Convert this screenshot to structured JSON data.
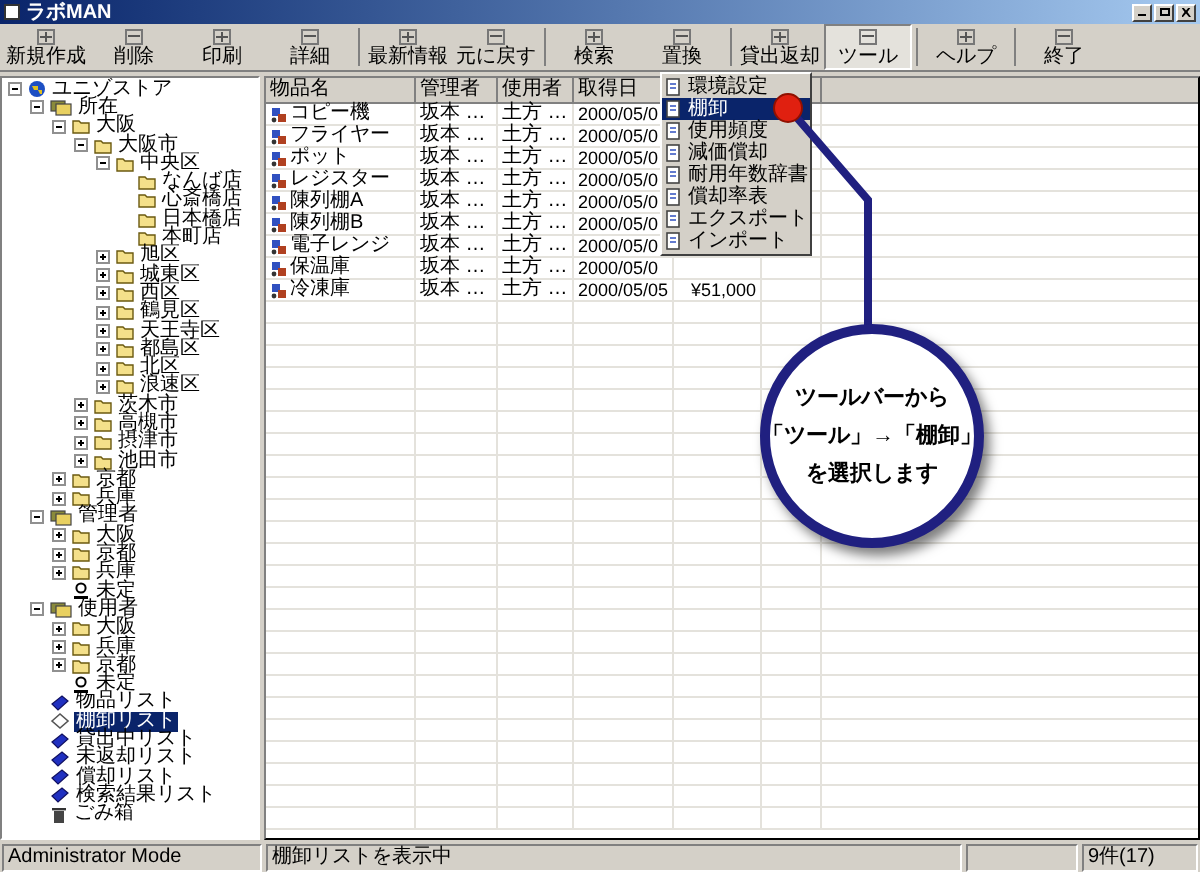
{
  "window": {
    "title": "ラボMAN"
  },
  "toolbar": [
    {
      "label": "新規作成",
      "pressed": false
    },
    {
      "label": "削除",
      "pressed": false
    },
    {
      "label": "印刷",
      "pressed": false
    },
    {
      "label": "詳細",
      "pressed": false
    },
    {
      "label": "最新情報",
      "pressed": false
    },
    {
      "label": "元に戻す",
      "pressed": false
    },
    {
      "label": "検索",
      "pressed": false
    },
    {
      "label": "置換",
      "pressed": false
    },
    {
      "label": "貸出返却",
      "pressed": false
    },
    {
      "label": "ツール",
      "pressed": true
    },
    {
      "label": "ヘルプ",
      "pressed": false
    },
    {
      "label": "終了",
      "pressed": false
    }
  ],
  "tree": [
    {
      "label": "ユニゾストア",
      "kind": "root",
      "expanded": true,
      "selected": false,
      "children": [
        {
          "label": "所在",
          "kind": "group",
          "expanded": true,
          "selected": false,
          "children": [
            {
              "label": "大阪",
              "kind": "folder",
              "expanded": true,
              "selected": false,
              "children": [
                {
                  "label": "大阪市",
                  "kind": "folder",
                  "expanded": true,
                  "selected": false,
                  "children": [
                    {
                      "label": "中央区",
                      "kind": "folder",
                      "expanded": true,
                      "selected": false,
                      "children": [
                        {
                          "label": "なんば店",
                          "kind": "folder",
                          "selected": false
                        },
                        {
                          "label": "心斎橋店",
                          "kind": "folder",
                          "selected": false
                        },
                        {
                          "label": "日本橋店",
                          "kind": "folder",
                          "selected": false
                        },
                        {
                          "label": "本町店",
                          "kind": "folder",
                          "selected": false
                        }
                      ]
                    },
                    {
                      "label": "旭区",
                      "kind": "folder",
                      "expanded": false,
                      "selected": false
                    },
                    {
                      "label": "城東区",
                      "kind": "folder",
                      "expanded": false,
                      "selected": false
                    },
                    {
                      "label": "西区",
                      "kind": "folder",
                      "expanded": false,
                      "selected": false
                    },
                    {
                      "label": "鶴見区",
                      "kind": "folder",
                      "expanded": false,
                      "selected": false
                    },
                    {
                      "label": "天王寺区",
                      "kind": "folder",
                      "expanded": false,
                      "selected": false
                    },
                    {
                      "label": "都島区",
                      "kind": "folder",
                      "expanded": false,
                      "selected": false
                    },
                    {
                      "label": "北区",
                      "kind": "folder",
                      "expanded": false,
                      "selected": false
                    },
                    {
                      "label": "浪速区",
                      "kind": "folder",
                      "expanded": false,
                      "selected": false
                    }
                  ]
                },
                {
                  "label": "茨木市",
                  "kind": "folder",
                  "expanded": false,
                  "selected": false
                },
                {
                  "label": "高槻市",
                  "kind": "folder",
                  "expanded": false,
                  "selected": false
                },
                {
                  "label": "摂津市",
                  "kind": "folder",
                  "expanded": false,
                  "selected": false
                },
                {
                  "label": "池田市",
                  "kind": "folder",
                  "expanded": false,
                  "selected": false
                }
              ]
            },
            {
              "label": "京都",
              "kind": "folder",
              "expanded": false,
              "selected": false
            },
            {
              "label": "兵庫",
              "kind": "folder",
              "expanded": false,
              "selected": false
            }
          ]
        },
        {
          "label": "管理者",
          "kind": "group",
          "expanded": true,
          "selected": false,
          "children": [
            {
              "label": "大阪",
              "kind": "folder",
              "expanded": false,
              "selected": false
            },
            {
              "label": "京都",
              "kind": "folder",
              "expanded": false,
              "selected": false
            },
            {
              "label": "兵庫",
              "kind": "folder",
              "expanded": false,
              "selected": false
            },
            {
              "label": "未定",
              "kind": "person",
              "selected": false
            }
          ]
        },
        {
          "label": "使用者",
          "kind": "group",
          "expanded": true,
          "selected": false,
          "children": [
            {
              "label": "大阪",
              "kind": "folder",
              "expanded": false,
              "selected": false
            },
            {
              "label": "兵庫",
              "kind": "folder",
              "expanded": false,
              "selected": false
            },
            {
              "label": "京都",
              "kind": "folder",
              "expanded": false,
              "selected": false
            },
            {
              "label": "未定",
              "kind": "person",
              "selected": false
            }
          ]
        },
        {
          "label": "物品リスト",
          "kind": "list",
          "selected": false
        },
        {
          "label": "棚卸リスト",
          "kind": "list",
          "selected": true
        },
        {
          "label": "貸出中リスト",
          "kind": "list",
          "selected": false
        },
        {
          "label": "未返却リスト",
          "kind": "list",
          "selected": false
        },
        {
          "label": "償却リスト",
          "kind": "list",
          "selected": false
        },
        {
          "label": "検索結果リスト",
          "kind": "list",
          "selected": false
        },
        {
          "label": "ごみ箱",
          "kind": "trash",
          "selected": false
        }
      ]
    }
  ],
  "table": {
    "columns": [
      "物品名",
      "管理者",
      "使用者",
      "取得日"
    ],
    "rows": [
      [
        "コピー機",
        "坂本 …",
        "土方 …",
        "2000/05/0"
      ],
      [
        "フライヤー",
        "坂本 …",
        "土方 …",
        "2000/05/0"
      ],
      [
        "ポット",
        "坂本 …",
        "土方 …",
        "2000/05/0"
      ],
      [
        "レジスター",
        "坂本 …",
        "土方 …",
        "2000/05/0"
      ],
      [
        "陳列棚A",
        "坂本 …",
        "土方 …",
        "2000/05/0"
      ],
      [
        "陳列棚B",
        "坂本 …",
        "土方 …",
        "2000/05/0"
      ],
      [
        "電子レンジ",
        "坂本 …",
        "土方 …",
        "2000/05/0"
      ],
      [
        "保温庫",
        "坂本 …",
        "土方 …",
        "2000/05/0"
      ],
      [
        "冷凍庫",
        "坂本 …",
        "土方 …",
        "2000/05/05",
        "¥51,000"
      ]
    ]
  },
  "menu": [
    {
      "label": "環境設定",
      "selected": false
    },
    {
      "label": "棚卸",
      "selected": true
    },
    {
      "label": "使用頻度",
      "selected": false
    },
    {
      "label": "減価償却",
      "selected": false
    },
    {
      "label": "耐用年数辞書",
      "selected": false
    },
    {
      "label": "償却率表",
      "selected": false
    },
    {
      "label": "エクスポート",
      "selected": false
    },
    {
      "label": "インポート",
      "selected": false
    }
  ],
  "callout": {
    "lines": [
      "ツールバーから",
      "「ツール」→「棚卸」",
      "を選択します"
    ]
  },
  "status_bar": [
    "Administrator Mode",
    "棚卸リストを表示中",
    "9件(17)"
  ]
}
